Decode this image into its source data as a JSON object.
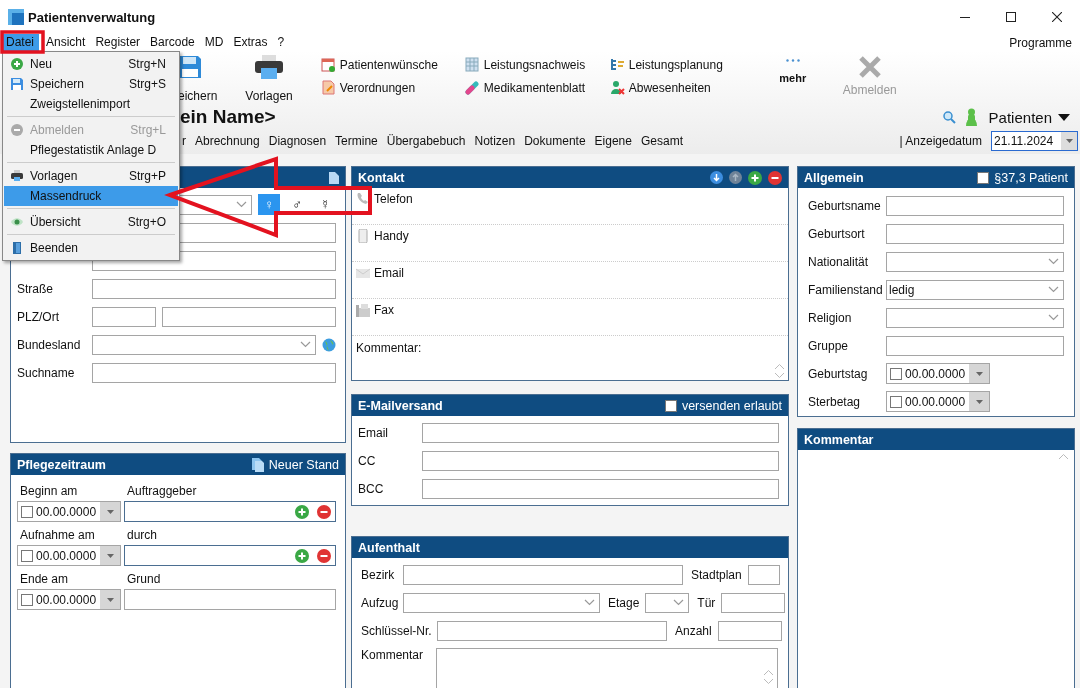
{
  "window": {
    "title": "Patientenverwaltung"
  },
  "menu_bar": {
    "items": [
      {
        "label": "Datei",
        "selected": true
      },
      {
        "label": "Ansicht",
        "selected": false
      },
      {
        "label": "Register",
        "selected": false
      },
      {
        "label": "Barcode",
        "selected": false
      },
      {
        "label": "MD",
        "selected": false
      },
      {
        "label": "Extras",
        "selected": false
      },
      {
        "label": "?",
        "selected": false
      }
    ],
    "right_label": "Programme"
  },
  "file_menu": {
    "items": [
      {
        "kind": "command",
        "label": "Neu",
        "shortcut": "Strg+N",
        "disabled": false,
        "selected": false
      },
      {
        "kind": "command",
        "label": "Speichern",
        "shortcut": "Strg+S",
        "disabled": false,
        "selected": false
      },
      {
        "kind": "command",
        "label": "Zweigstellenimport",
        "disabled": false,
        "selected": false
      },
      {
        "kind": "separator"
      },
      {
        "kind": "command",
        "label": "Abmelden",
        "shortcut": "Strg+L",
        "disabled": true,
        "selected": false
      },
      {
        "kind": "command",
        "label": "Pflegestatistik Anlage D",
        "disabled": false,
        "selected": false
      },
      {
        "kind": "separator"
      },
      {
        "kind": "command",
        "label": "Vorlagen",
        "shortcut": "Strg+P",
        "disabled": false,
        "selected": false
      },
      {
        "kind": "command",
        "label": "Massendruck",
        "disabled": false,
        "selected": true
      },
      {
        "kind": "separator"
      },
      {
        "kind": "command",
        "label": "Übersicht",
        "shortcut": "Strg+O",
        "disabled": false,
        "selected": false
      },
      {
        "kind": "separator"
      },
      {
        "kind": "command",
        "label": "Beenden",
        "disabled": false,
        "selected": false
      }
    ]
  },
  "toolbar": {
    "buttons": [
      {
        "label": "eichern"
      },
      {
        "label": "Vorlagen"
      }
    ],
    "links": [
      {
        "label": "Patientenwünsche"
      },
      {
        "label": "Verordnungen"
      },
      {
        "label": "Leistungsnachweis"
      },
      {
        "label": "Medikamentenblatt"
      },
      {
        "label": "Leistungsplanung"
      },
      {
        "label": "Abwesenheiten"
      }
    ],
    "more_button": {
      "label": "mehr"
    },
    "logout_button": {
      "label": "Abmelden",
      "disabled": true
    }
  },
  "patient_header": {
    "title": "ein Name>",
    "list_selector": "Patienten"
  },
  "tabs": [
    {
      "label": "r",
      "selected": false
    },
    {
      "label": "Abrechnung",
      "selected": false
    },
    {
      "label": "Diagnosen",
      "selected": false
    },
    {
      "label": "Termine",
      "selected": false
    },
    {
      "label": "Übergabebuch",
      "selected": false
    },
    {
      "label": "Notizen",
      "selected": false
    },
    {
      "label": "Dokumente",
      "selected": false
    },
    {
      "label": "Eigene",
      "selected": false
    },
    {
      "label": "Gesamt",
      "selected": false
    }
  ],
  "display_date": {
    "label": "| Anzeigedatum",
    "value": "21.11.2024"
  },
  "person_panel": {
    "rows": [
      {
        "controls": [
          {
            "kind": "combo"
          },
          {
            "kind": "gender",
            "options": [
              {
                "symbol": "♀",
                "selected": true
              },
              {
                "symbol": "♂",
                "selected": false
              },
              {
                "symbol": "☿",
                "selected": false
              }
            ]
          }
        ]
      },
      {
        "controls": [
          {
            "kind": "input"
          }
        ]
      },
      {
        "controls": [
          {
            "kind": "input"
          }
        ]
      },
      {
        "label": "Straße",
        "controls": [
          {
            "kind": "input"
          }
        ]
      },
      {
        "label": "PLZ/Ort",
        "controls": [
          {
            "kind": "input_short"
          },
          {
            "kind": "input"
          }
        ]
      },
      {
        "label": "Bundesland",
        "controls": [
          {
            "kind": "combo"
          },
          {
            "kind": "globe"
          }
        ]
      },
      {
        "label": "Suchname",
        "controls": [
          {
            "kind": "input"
          }
        ]
      }
    ]
  },
  "care_period_panel": {
    "title": "Pflegezeitraum",
    "action": "Neuer Stand",
    "rows": [
      {
        "date_label": "Beginn am",
        "date": {
          "value": "00.00.0000",
          "checked": false
        },
        "field_label": "Auftraggeber",
        "add_remove": true
      },
      {
        "date_label": "Aufnahme am",
        "date": {
          "value": "00.00.0000",
          "checked": false
        },
        "field_label": "durch",
        "add_remove": true
      },
      {
        "date_label": "Ende am",
        "date": {
          "value": "00.00.0000",
          "checked": false
        },
        "field_label": "Grund",
        "add_remove": false
      }
    ]
  },
  "contact_panel": {
    "title": "Kontakt",
    "entries": [
      {
        "label": "Telefon"
      },
      {
        "label": "Handy"
      },
      {
        "label": "Email"
      },
      {
        "label": "Fax"
      }
    ],
    "comment_label": "Kommentar:"
  },
  "email_panel": {
    "title": "E-Mailversand",
    "allowed": {
      "label": "versenden erlaubt",
      "checked": false
    },
    "fields": [
      {
        "label": "Email"
      },
      {
        "label": "CC"
      },
      {
        "label": "BCC"
      }
    ]
  },
  "stay_panel": {
    "title": "Aufenthalt",
    "rows": [
      [
        {
          "label": "Bezirk",
          "kind": "input"
        },
        {
          "label": "Stadtplan",
          "kind": "input"
        }
      ],
      [
        {
          "label": "Aufzug",
          "kind": "combo"
        },
        {
          "label": "Etage",
          "kind": "combo"
        },
        {
          "label": "Tür",
          "kind": "input"
        }
      ],
      [
        {
          "label": "Schlüssel-Nr.",
          "kind": "input"
        },
        {
          "label": "Anzahl",
          "kind": "input"
        }
      ],
      [
        {
          "label": "Kommentar",
          "kind": "textarea"
        }
      ]
    ]
  },
  "general_panel": {
    "title": "Allgemein",
    "flag": {
      "label": "§37,3 Patient",
      "checked": false
    },
    "fields": [
      {
        "label": "Geburtsname",
        "kind": "input"
      },
      {
        "label": "Geburtsort",
        "kind": "input"
      },
      {
        "label": "Nationalität",
        "kind": "combo"
      },
      {
        "label": "Familienstand",
        "kind": "combo",
        "value": "ledig"
      },
      {
        "label": "Religion",
        "kind": "combo"
      },
      {
        "label": "Gruppe",
        "kind": "input"
      },
      {
        "label": "Geburtstag",
        "kind": "date",
        "value": "00.00.0000",
        "checked": false
      },
      {
        "label": "Sterbetag",
        "kind": "date",
        "value": "00.00.0000",
        "checked": false
      }
    ]
  },
  "comment_panel": {
    "title": "Kommentar"
  }
}
